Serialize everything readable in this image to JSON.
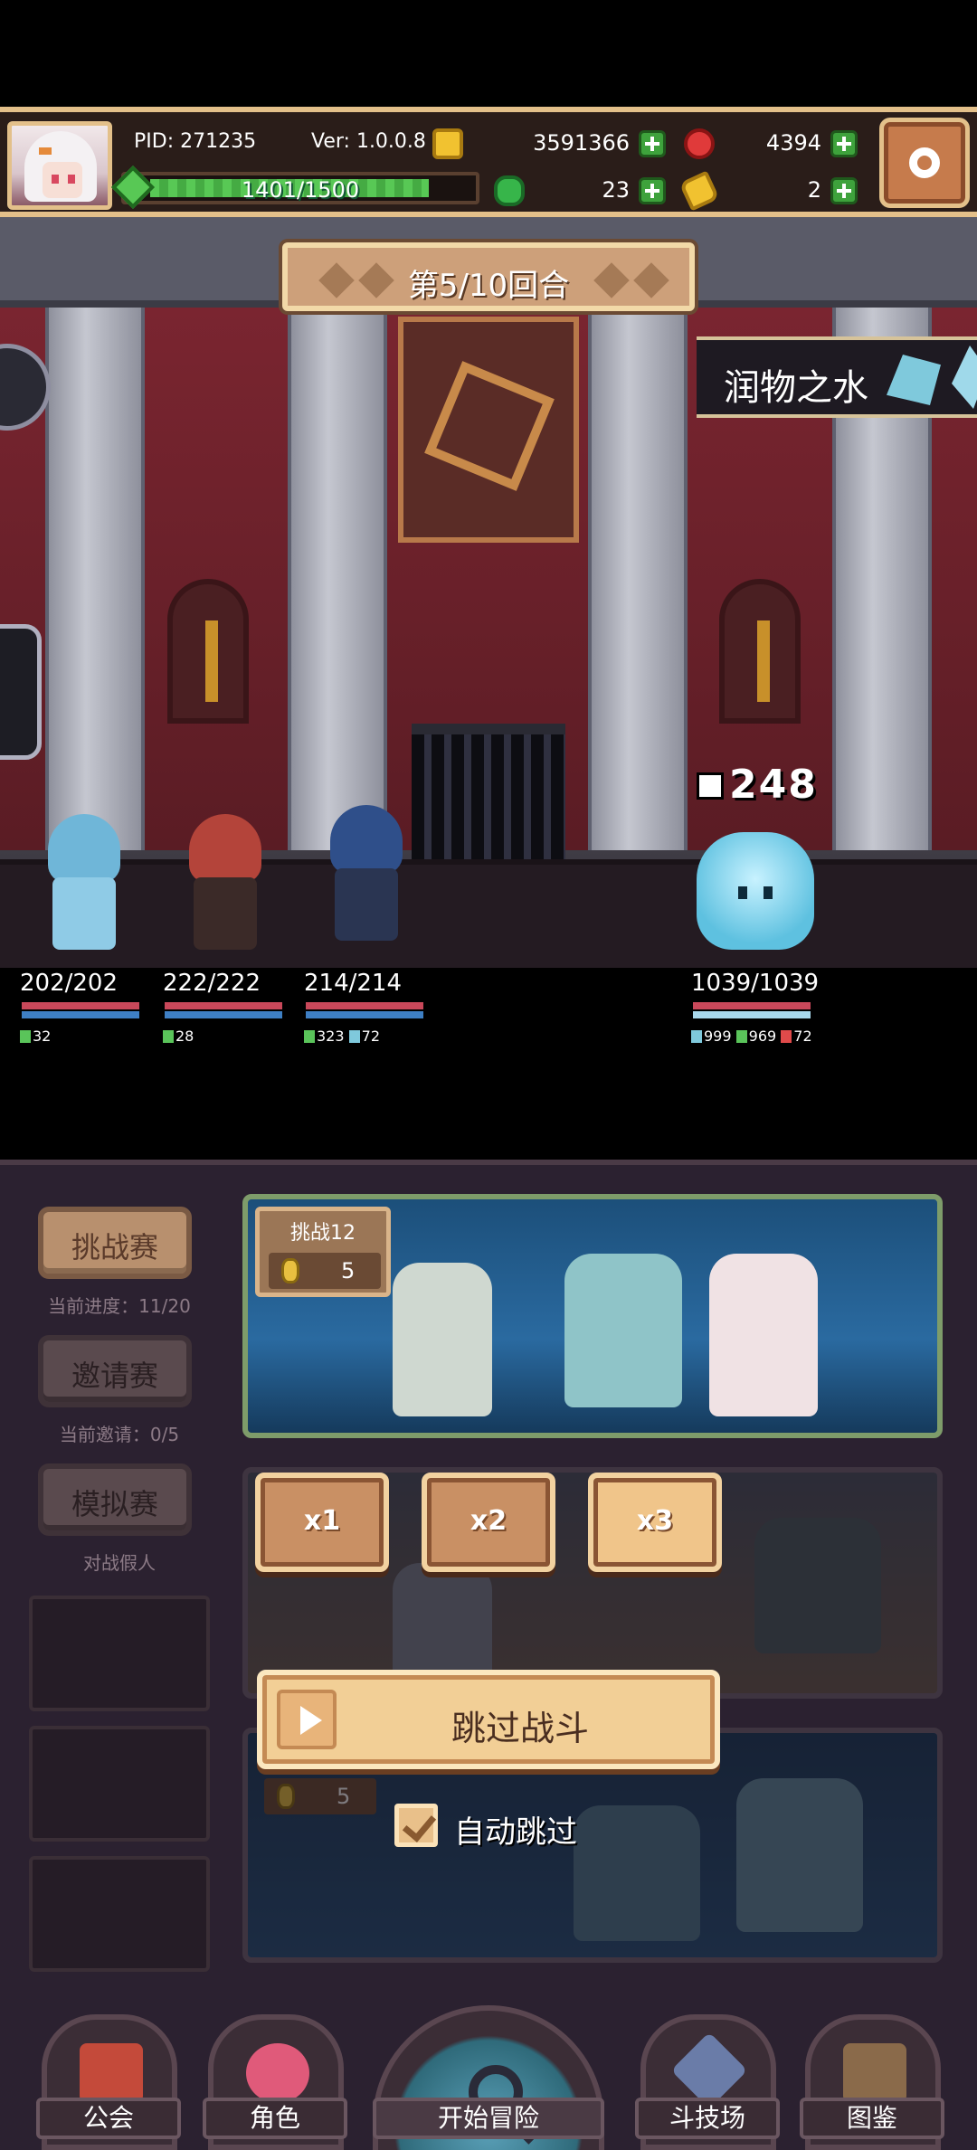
{
  "hud": {
    "pid": "PID: 271235",
    "version": "Ver: 1.0.0.8",
    "gold": "3591366",
    "ruby": "4394",
    "clover": "23",
    "potion": "2",
    "xp_text": "1401/1500",
    "xp_progress": 0.934
  },
  "battle": {
    "round": "第5/10回合",
    "skill_name": "润物之水",
    "damage": "248",
    "heroes": [
      {
        "hp": "202/202",
        "stats": [
          "32"
        ]
      },
      {
        "hp": "222/222",
        "stats": [
          "28"
        ]
      },
      {
        "hp": "214/214",
        "stats": [
          "323",
          "72"
        ]
      }
    ],
    "enemy": {
      "hp": "1039/1039",
      "stats": [
        "999",
        "969",
        "72"
      ]
    }
  },
  "modes": [
    {
      "label": "挑战赛",
      "sub": "当前进度：11/20"
    },
    {
      "label": "邀请赛",
      "sub": "当前邀请：0/5"
    },
    {
      "label": "模拟赛",
      "sub": "对战假人"
    }
  ],
  "cards": [
    {
      "title": "挑战12",
      "cost": "5"
    },
    {
      "cost": "5"
    }
  ],
  "speed": [
    "x1",
    "x2",
    "x3"
  ],
  "skip_label": "跳过战斗",
  "auto_skip_label": "自动跳过",
  "nav": [
    "公会",
    "角色",
    "开始冒险",
    "斗技场",
    "图鉴"
  ],
  "colors": {
    "accent_gold": "#e3c08a",
    "button_tan": "#c99064",
    "hp_red": "#c9485a",
    "mp_blue": "#3e7fc4"
  }
}
